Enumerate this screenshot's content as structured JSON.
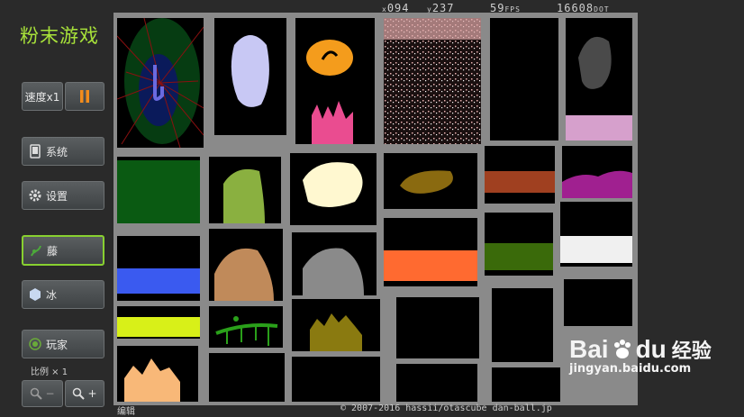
{
  "app": {
    "title": "粉末游戏"
  },
  "status": {
    "x": "094",
    "y": "237",
    "fps": "59",
    "fps_unit": "FPS",
    "dots": "16608",
    "dots_unit": "DOT"
  },
  "controls": {
    "speed_label": "速度x1",
    "system_label": "系统",
    "settings_label": "设置",
    "vine_label": "藤",
    "ice_label": "冰",
    "player_label": "玩家",
    "scale_label": "比例 × 1",
    "zoom_out_label": "−",
    "zoom_in_label": "+"
  },
  "footer": {
    "edit": "编辑",
    "copyright": "© 2007-2016 hassii/otascube dan-ball.jp"
  },
  "watermark": {
    "brand": "Bai",
    "brand2": "du",
    "brand_cn": "经验",
    "url": "jingyan.baidu.com"
  },
  "colors": {
    "accent": "#a8e23a",
    "pause": "#f28c1c",
    "board_gray": "#8a8a8a"
  }
}
